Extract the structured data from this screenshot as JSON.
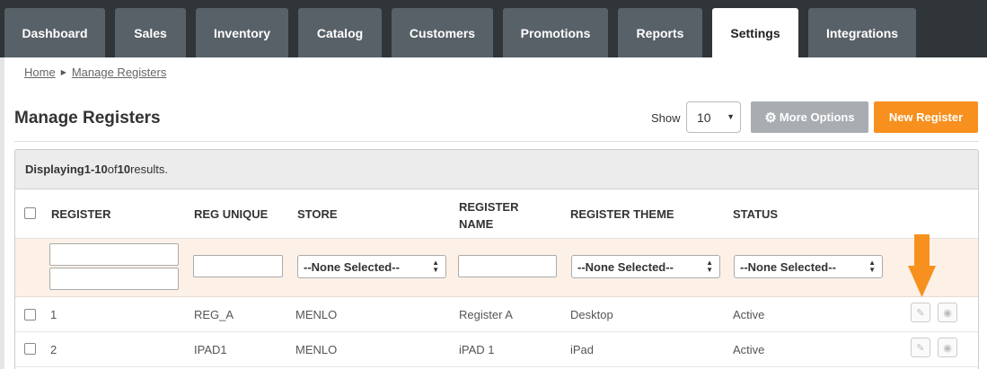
{
  "nav": {
    "tabs": [
      {
        "label": "Dashboard"
      },
      {
        "label": "Sales"
      },
      {
        "label": "Inventory"
      },
      {
        "label": "Catalog"
      },
      {
        "label": "Customers"
      },
      {
        "label": "Promotions"
      },
      {
        "label": "Reports"
      },
      {
        "label": "Settings",
        "active": true
      },
      {
        "label": "Integrations"
      }
    ]
  },
  "breadcrumb": {
    "home": "Home",
    "current": "Manage Registers"
  },
  "page": {
    "title": "Manage Registers"
  },
  "toolbar": {
    "show_label": "Show",
    "show_value": "10",
    "more_options_label": "More Options",
    "new_register_label": "New Register"
  },
  "summary": {
    "prefix": "Displaying ",
    "range": "1-10",
    "of": " of ",
    "total": "10",
    "suffix": " results."
  },
  "columns": {
    "register": "REGISTER",
    "reg_unique": "REG UNIQUE",
    "store": "STORE",
    "register_name_1": "REGISTER",
    "register_name_2": "NAME",
    "register_theme": "REGISTER THEME",
    "status": "STATUS"
  },
  "filters": {
    "store": "--None Selected--",
    "theme": "--None Selected--",
    "status": "--None Selected--"
  },
  "rows": [
    {
      "register": "1",
      "reg_unique": "REG_A",
      "store": "MENLO",
      "name": "Register A",
      "theme": "Desktop",
      "status": "Active"
    },
    {
      "register": "2",
      "reg_unique": "IPAD1",
      "store": "MENLO",
      "name": "iPAD 1",
      "theme": "iPad",
      "status": "Active"
    }
  ],
  "colors": {
    "nav_bg": "#2f3538",
    "tab_bg": "#596168",
    "accent_orange": "#f7901e",
    "filter_bg": "#fdf1e7"
  },
  "icons": {
    "edit": "pencil-icon",
    "view": "eye-icon",
    "gear": "gear-icon",
    "annotation": "down-arrow-icon"
  }
}
